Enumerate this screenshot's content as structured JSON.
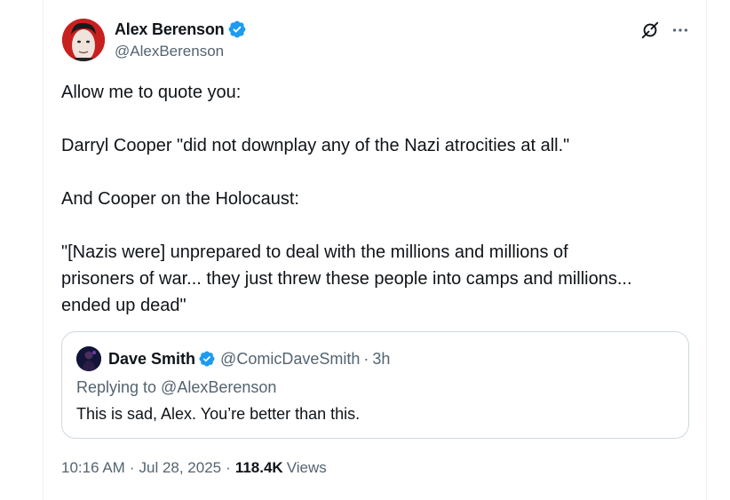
{
  "author": {
    "display_name": "Alex Berenson",
    "handle": "@AlexBerenson",
    "verified_icon": "verified-badge-icon",
    "avatar_color": "#d01818"
  },
  "actions": {
    "grok_icon": "grok-icon",
    "more_icon": "more-horizontal-icon"
  },
  "tweet": {
    "lines": [
      "Allow me to quote you:",
      "Darryl Cooper \"did not downplay any of the Nazi atrocities at all.\"",
      "And Cooper on the Holocaust:",
      "\"[Nazis were] unprepared to deal with the millions and millions of",
      "prisoners of war... they just threw these people into camps and millions...",
      "ended up dead\""
    ]
  },
  "quote": {
    "display_name": "Dave Smith",
    "handle": "@ComicDaveSmith",
    "separator": "·",
    "time": "3h",
    "replying_to": "Replying to @AlexBerenson",
    "text": "This is sad, Alex. You’re better than this."
  },
  "meta": {
    "time": "10:16 AM",
    "separator": "·",
    "date": "Jul 28, 2025",
    "views_count": "118.4K",
    "views_label": "Views"
  },
  "colors": {
    "verified_blue": "#1d9bf0",
    "secondary_text": "#536471",
    "primary_text": "#0f1419",
    "border": "#cfd9de"
  }
}
